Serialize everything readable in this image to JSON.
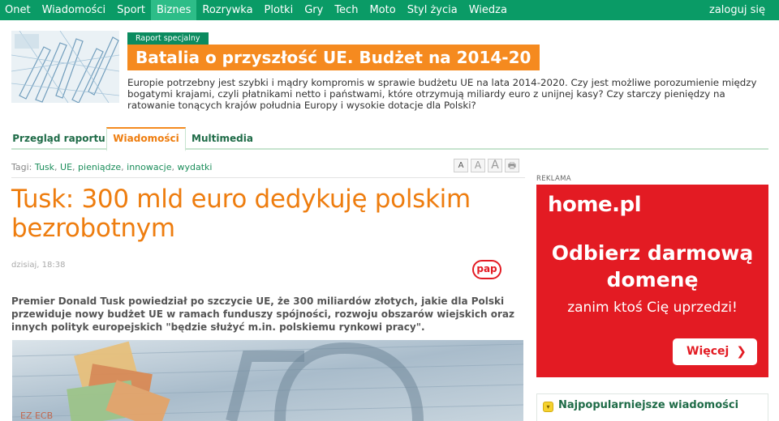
{
  "nav": {
    "items": [
      "Onet",
      "Wiadomości",
      "Sport",
      "Biznes",
      "Rozrywka",
      "Plotki",
      "Gry",
      "Tech",
      "Moto",
      "Styl życia",
      "Wiedza"
    ],
    "active": "Biznes",
    "login": "zaloguj się"
  },
  "report": {
    "badge": "Raport specjalny",
    "title": "Batalia o przyszłość UE. Budżet na 2014-20",
    "description": "Europie potrzebny jest szybki i mądry kompromis w sprawie budżetu UE na lata 2014-2020. Czy jest możliwe porozumienie między bogatymi krajami, czyli płatnikami netto i państwami, które otrzymują miliardy euro z unijnej kasy? Czy starczy pieniędzy na ratowanie tonących krajów południa Europy i wysokie dotacje dla Polski?"
  },
  "tabs": [
    "Przegląd raportu",
    "Wiadomości",
    "Multimedia"
  ],
  "tags": {
    "label": "Tagi:",
    "items": [
      "Tusk",
      "UE",
      "pieniądze",
      "innowacje",
      "wydatki"
    ]
  },
  "tools": {
    "font_small": "A",
    "font_medium": "A",
    "font_large": "A",
    "print": "🖶"
  },
  "article": {
    "headline": "Tusk: 300 mld euro dedykuję polskim bezrobotnym",
    "date": "dzisiaj, 18:38",
    "source": "pap",
    "lead": "Premier Donald Tusk powiedział po szczycie UE, że 300 miliardów złotych, jakie dla Polski przewiduje nowy budżet UE w ramach funduszy spójności, rozwoju obszarów wiejskich oraz innych polityk europejskich \"będzie służyć m.in. polskiemu rynkowi pracy\"."
  },
  "ad": {
    "label": "REKLAMA",
    "brand": "home.pl",
    "headline": "Odbierz darmową domenę",
    "sub": "zanim ktoś Cię uprzedzi!",
    "button": "Więcej",
    "chevron": "❯",
    "color": "#e31b23"
  },
  "popular": {
    "title": "Najpopularniejsze wiadomości",
    "icon": "chevron-down-icon"
  },
  "colors": {
    "nav_bg": "#0a9b66",
    "nav_active": "#2dbd88",
    "accent_orange": "#f58a1f",
    "link_green": "#1b8d5a"
  }
}
